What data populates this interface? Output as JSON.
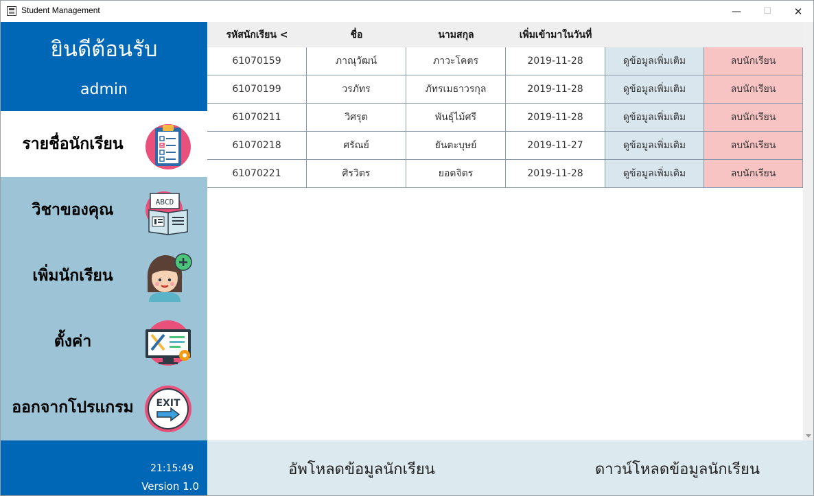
{
  "window": {
    "title": "Student Management",
    "minimize": "—",
    "maximize": "☐",
    "close": "✕"
  },
  "sidebar": {
    "welcome": "ยินดีต้อนรับ",
    "user": "admin",
    "items": [
      {
        "label": "รายชื่อนักเรียน",
        "icon": "clipboard-checklist-icon",
        "active": true
      },
      {
        "label": "วิชาของคุณ",
        "icon": "open-book-abcd-icon",
        "active": false
      },
      {
        "label": "เพิ่มนักเรียน",
        "icon": "add-student-avatar-icon",
        "active": false
      },
      {
        "label": "ตั้งค่า",
        "icon": "settings-monitor-tools-icon",
        "active": false
      },
      {
        "label": "ออกจากโปรแกรม",
        "icon": "exit-sign-icon",
        "active": false
      }
    ],
    "clock": "21:15:49",
    "version": "Version 1.0",
    "colors": {
      "header": "#0067b6",
      "body": "#9dc4d6",
      "active": "#ffffff"
    }
  },
  "table": {
    "headers": [
      "รหัสนักเรียน <",
      "ชื่อ",
      "นามสกุล",
      "เพิ่มเข้ามาในวันที่",
      "",
      ""
    ],
    "rows": [
      {
        "id": "61070159",
        "first": "ภาณุวัฒน์",
        "last": "ภาวะโคตร",
        "date": "2019-11-28",
        "view": "ดูข้อมูลเพิ่มเติม",
        "delete": "ลบนักเรียน"
      },
      {
        "id": "61070199",
        "first": "วรภัทร",
        "last": "ภัทรเมธาวรกุล",
        "date": "2019-11-28",
        "view": "ดูข้อมูลเพิ่มเติม",
        "delete": "ลบนักเรียน"
      },
      {
        "id": "61070211",
        "first": "วิศรุต",
        "last": "พันธุ์ไม้ศรี",
        "date": "2019-11-28",
        "view": "ดูข้อมูลเพิ่มเติม",
        "delete": "ลบนักเรียน"
      },
      {
        "id": "61070218",
        "first": "ศรัณย์",
        "last": "ยันตะบุษย์",
        "date": "2019-11-27",
        "view": "ดูข้อมูลเพิ่มเติม",
        "delete": "ลบนักเรียน"
      },
      {
        "id": "61070221",
        "first": "ศิรวิตร",
        "last": "ยอดจิตร",
        "date": "2019-11-28",
        "view": "ดูข้อมูลเพิ่มเติม",
        "delete": "ลบนักเรียน"
      }
    ],
    "colors": {
      "header_bg": "#efefef",
      "view_bg": "#d9e6ee",
      "delete_bg": "#f8c3c3",
      "border": "#8a9aaa"
    }
  },
  "bottom": {
    "upload": "อัพโหลดข้อมูลนักเรียน",
    "download": "ดาวน์โหลดข้อมูลนักเรียน"
  }
}
